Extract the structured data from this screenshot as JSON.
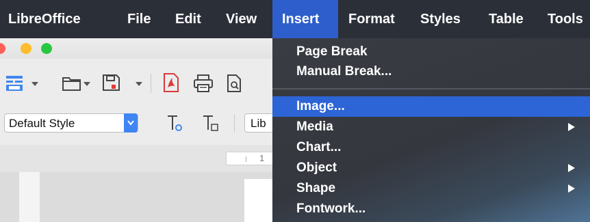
{
  "menubar": {
    "items": [
      {
        "label": "LibreOffice"
      },
      {
        "label": "File"
      },
      {
        "label": "Edit"
      },
      {
        "label": "View"
      },
      {
        "label": "Insert",
        "active": true
      },
      {
        "label": "Format"
      },
      {
        "label": "Styles"
      },
      {
        "label": "Table"
      },
      {
        "label": "Tools"
      }
    ]
  },
  "window": {
    "traffic_lights": [
      "close",
      "minimize",
      "zoom"
    ],
    "colors": {
      "close": "#fd5f57",
      "minimize": "#febc2e",
      "zoom": "#28c840"
    }
  },
  "toolbar": {
    "icons": [
      "new-document-icon",
      "open-folder-icon",
      "save-icon",
      "export-pdf-icon",
      "print-icon",
      "print-preview-icon"
    ],
    "paragraph_style": "Default Style",
    "font_name": "Lib",
    "ruler_number": "1"
  },
  "insert_menu": {
    "items": [
      {
        "label": "Page Break",
        "submenu": false
      },
      {
        "label": "Manual Break...",
        "submenu": false
      },
      {
        "label": "Image...",
        "submenu": false,
        "highlighted": true
      },
      {
        "label": "Media",
        "submenu": true
      },
      {
        "label": "Chart...",
        "submenu": false
      },
      {
        "label": "Object",
        "submenu": true
      },
      {
        "label": "Shape",
        "submenu": true
      },
      {
        "label": "Fontwork...",
        "submenu": false
      }
    ]
  },
  "colors": {
    "menubar_bg": "#2b2f38",
    "accent": "#2d64d6",
    "style_dropdown_button": "#3f86f2"
  }
}
